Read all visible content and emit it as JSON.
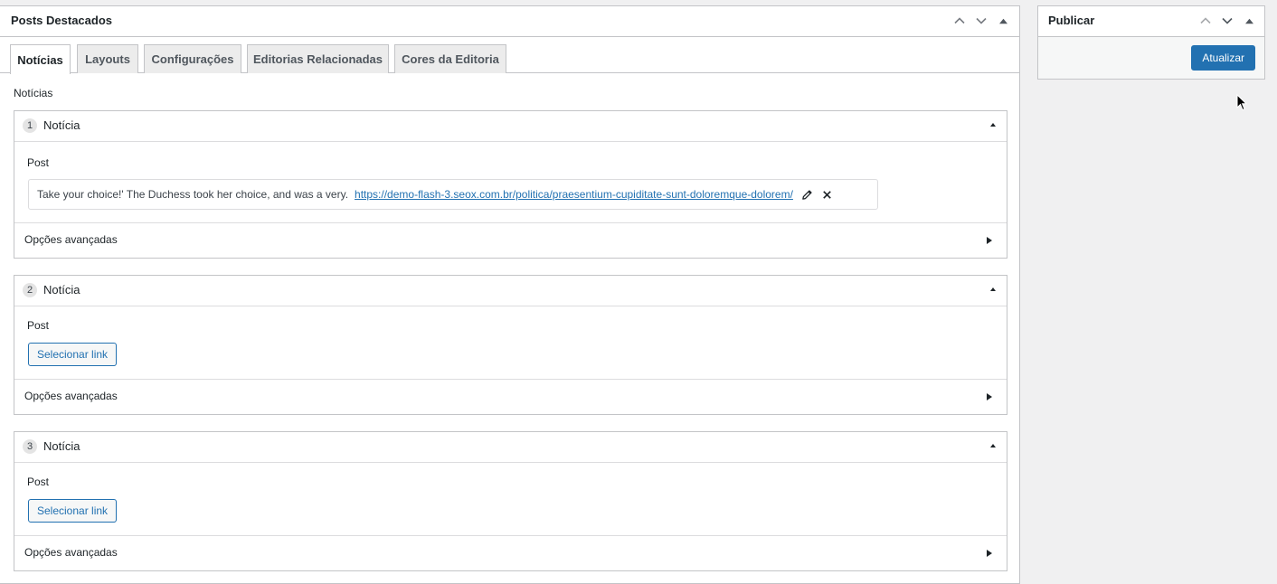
{
  "main_box": {
    "title": "Posts Destacados",
    "tabs": [
      {
        "label": "Notícias",
        "active": true
      },
      {
        "label": "Layouts",
        "active": false
      },
      {
        "label": "Configurações",
        "active": false
      },
      {
        "label": "Editorias Relacionadas",
        "active": false
      },
      {
        "label": "Cores da Editoria",
        "active": false
      }
    ],
    "section_label": "Notícias",
    "items": [
      {
        "number": "1",
        "title": "Notícia",
        "post_label": "Post",
        "selected_post_title": "Take your choice!' The Duchess took her choice, and was a very.",
        "selected_post_url": "https://demo-flash-3.seox.com.br/politica/praesentium-cupiditate-sunt-doloremque-dolorem/",
        "advanced_label": "Opções avançadas"
      },
      {
        "number": "2",
        "title": "Notícia",
        "post_label": "Post",
        "select_button": "Selecionar link",
        "advanced_label": "Opções avançadas"
      },
      {
        "number": "3",
        "title": "Notícia",
        "post_label": "Post",
        "select_button": "Selecionar link",
        "advanced_label": "Opções avançadas"
      }
    ]
  },
  "publish_box": {
    "title": "Publicar",
    "update_button": "Atualizar"
  },
  "colors": {
    "primary": "#2271b1",
    "border": "#c3c4c7",
    "background": "#f0f0f1"
  }
}
